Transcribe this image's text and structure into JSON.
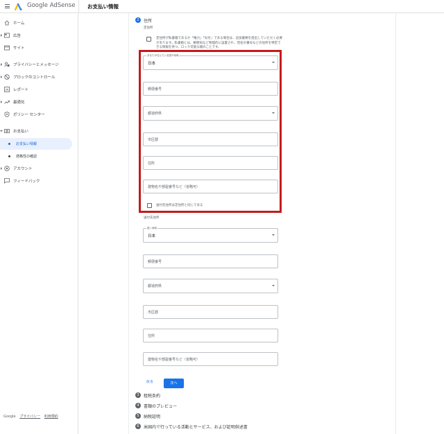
{
  "header": {
    "brand_google": "Google",
    "brand_product": "AdSense",
    "page_title": "お支払い情報"
  },
  "sidebar": {
    "items": [
      {
        "label": "ホーム",
        "icon": "home-icon"
      },
      {
        "label": "広告",
        "icon": "ads-icon"
      },
      {
        "label": "サイト",
        "icon": "sites-icon"
      },
      {
        "label": "プライバシーとメッセージ",
        "icon": "privacy-icon"
      },
      {
        "label": "ブロックのコントロール",
        "icon": "block-icon"
      },
      {
        "label": "レポート",
        "icon": "reports-icon"
      },
      {
        "label": "最適化",
        "icon": "optimization-icon"
      },
      {
        "label": "ポリシー センター",
        "icon": "policy-icon"
      },
      {
        "label": "お支払い",
        "icon": "payments-icon"
      },
      {
        "label": "お支払い情報"
      },
      {
        "label": "適格性の確認"
      },
      {
        "label": "アカウント",
        "icon": "account-icon"
      },
      {
        "label": "フィードバック",
        "icon": "feedback-icon"
      }
    ],
    "footer": {
      "google": "Google",
      "privacy": "プライバシー",
      "terms": "利用規約"
    }
  },
  "form": {
    "step2_number": "2",
    "step2_title": "住所",
    "permanent_label": "定住所",
    "notice": "定住所が私書箱であるか「権力」「気付」である場合は、追加書類を提出していただく必要があります。私書箱とは、郵便局など物理的に設置され、宛名の番号などの住所を特定できる情報を持つ、ロック可能な箱のことです。",
    "address": {
      "country_label": "あなたが住んでいる国や地域",
      "country_value": "日本",
      "postal": "郵便番号",
      "prefecture": "都道府県",
      "city": "市区郡",
      "street": "住所",
      "building": "建物名や部屋番号など（省略可）",
      "same_as_mailing": "送付先住所は定住所と同じである"
    },
    "mailing_label": "送付先住所",
    "mailing": {
      "country_label": "国 / 地域",
      "country_value": "日本",
      "postal": "郵便番号",
      "prefecture": "都道府県",
      "city": "市区郡",
      "street": "住所",
      "building": "建物名や部屋番号など（省略可）"
    },
    "back_button": "戻る",
    "next_button": "次へ",
    "steps": [
      {
        "number": "3",
        "title": "租税条約"
      },
      {
        "number": "4",
        "title": "書類のプレビュー"
      },
      {
        "number": "5",
        "title": "納税証明"
      },
      {
        "number": "6",
        "title": "米国内で行っている活動とサービス、および証明供述書"
      }
    ]
  },
  "colors": {
    "accent": "#1a73e8",
    "highlight_border": "#c41a1a",
    "active_nav_bg": "#e8f0fe"
  }
}
